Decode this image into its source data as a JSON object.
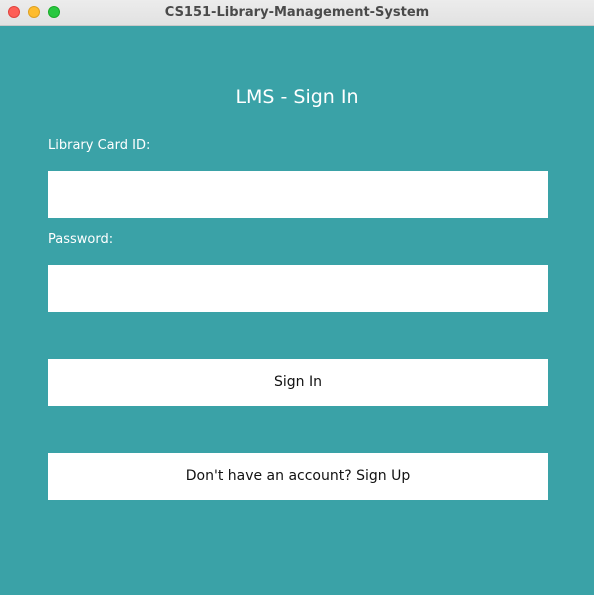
{
  "window": {
    "title": "CS151-Library-Management-System"
  },
  "form": {
    "heading": "LMS - Sign In",
    "card_id_label": "Library Card ID:",
    "card_id_value": "",
    "password_label": "Password:",
    "password_value": "",
    "sign_in_label": "Sign In",
    "sign_up_label": "Don't have an account? Sign Up"
  },
  "colors": {
    "background": "#3aa2a7",
    "field_background": "#ffffff",
    "text_on_background": "#ffffff"
  }
}
